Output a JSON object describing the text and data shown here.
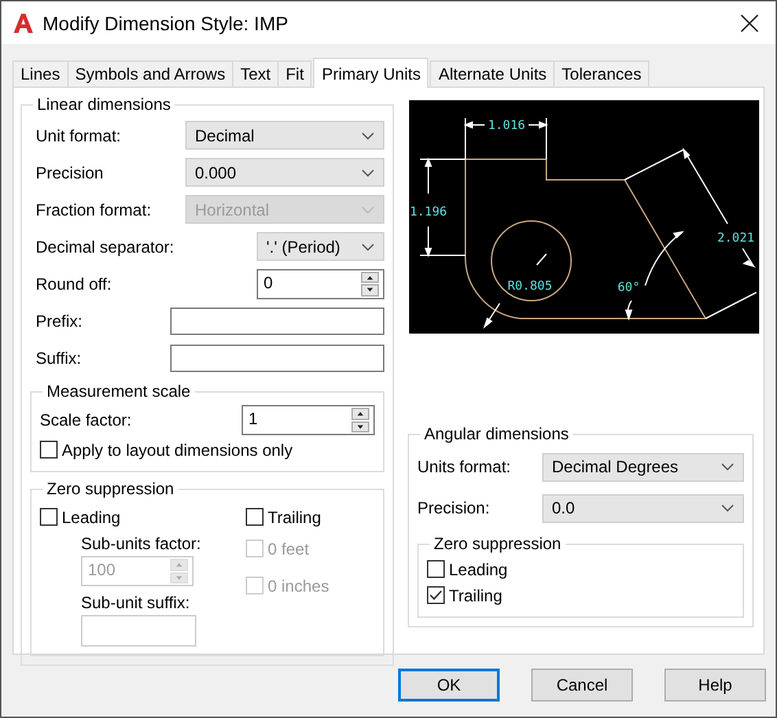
{
  "window": {
    "title": "Modify Dimension Style: IMP"
  },
  "tabs": [
    {
      "label": "Lines",
      "selected": false
    },
    {
      "label": "Symbols and Arrows",
      "selected": false
    },
    {
      "label": "Text",
      "selected": false
    },
    {
      "label": "Fit",
      "selected": false
    },
    {
      "label": "Primary Units",
      "selected": true
    },
    {
      "label": "Alternate Units",
      "selected": false
    },
    {
      "label": "Tolerances",
      "selected": false
    }
  ],
  "linear_dimensions": {
    "title": "Linear dimensions",
    "fields": [
      {
        "kind": "dropdown",
        "label": "Unit format:",
        "value": "Decimal",
        "disabled": false
      },
      {
        "kind": "dropdown",
        "label": "Precision",
        "value": "0.000",
        "disabled": false
      },
      {
        "kind": "dropdown",
        "label": "Fraction format:",
        "value": "Horizontal",
        "disabled": true
      },
      {
        "kind": "dropdown",
        "label": "Decimal separator:",
        "value": "'.' (Period)",
        "disabled": false
      },
      {
        "kind": "spinner",
        "label": "Round off:",
        "value": "0",
        "disabled": false
      },
      {
        "kind": "text",
        "label": "Prefix:"
      },
      {
        "kind": "text",
        "label": "Suffix:"
      }
    ]
  },
  "measurement_scale": {
    "title": "Measurement scale",
    "scale_factor": {
      "label": "Scale factor:",
      "value": "1",
      "disabled": false
    },
    "apply_layout": {
      "label": "Apply to layout dimensions only",
      "checked": false,
      "disabled": false
    }
  },
  "zero_suppression": {
    "title": "Zero suppression",
    "leading": {
      "label": "Leading",
      "checked": false,
      "disabled": false
    },
    "sub_units_factor": {
      "label": "Sub-units factor:",
      "value": "100",
      "disabled": true
    },
    "sub_unit_suffix": {
      "label": "Sub-unit suffix:"
    },
    "trailing": {
      "label": "Trailing",
      "checked": false,
      "disabled": false
    },
    "zero_feet": {
      "label": "0 feet",
      "checked": false,
      "disabled": true
    },
    "zero_inches": {
      "label": "0 inches",
      "checked": false,
      "disabled": true
    }
  },
  "preview": {
    "labels": [
      "1.016",
      "1.196",
      "R0.805",
      "60°",
      "2.021"
    ]
  },
  "angular_dimensions": {
    "title": "Angular dimensions",
    "units_format": {
      "label": "Units format:",
      "value": "Decimal Degrees",
      "disabled": false
    },
    "precision": {
      "label": "Precision:",
      "value": "0.0",
      "disabled": false
    },
    "zero_suppression": {
      "title": "Zero suppression",
      "leading": {
        "label": "Leading",
        "checked": false,
        "disabled": false
      },
      "trailing": {
        "label": "Trailing",
        "checked": true,
        "disabled": false
      }
    }
  },
  "buttons": [
    {
      "label": "OK",
      "default": true
    },
    {
      "label": "Cancel",
      "default": false
    },
    {
      "label": "Help",
      "default": false
    }
  ]
}
